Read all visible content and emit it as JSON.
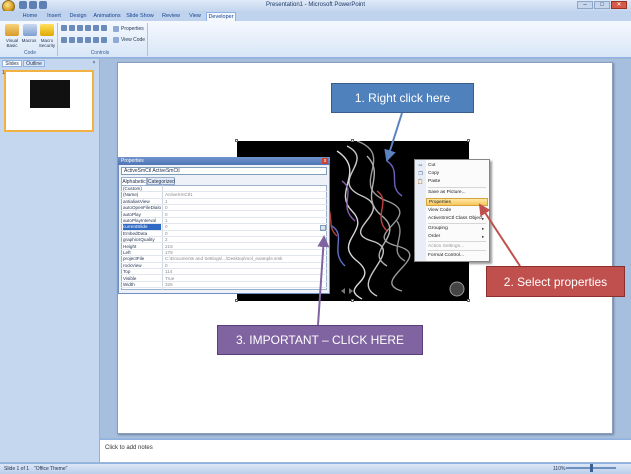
{
  "window": {
    "title": "Presentation1 - Microsoft PowerPoint",
    "min": "–",
    "max": "□",
    "close": "✕"
  },
  "ribbon": {
    "tabs": [
      "Home",
      "Insert",
      "Design",
      "Animations",
      "Slide Show",
      "Review",
      "View",
      "Developer"
    ],
    "active_tab": "Developer",
    "groups": {
      "code": {
        "label": "Code",
        "visual_basic": "Visual Basic",
        "macros": "Macros",
        "macro_security": "Macro Security"
      },
      "controls": {
        "label": "Controls",
        "properties": "Properties",
        "view_code": "View Code"
      }
    }
  },
  "left_pane": {
    "tab_slides": "Slides",
    "tab_outline": "Outline",
    "close": "×",
    "thumb_number": "1"
  },
  "notes": {
    "placeholder": "Click to add notes"
  },
  "status": {
    "slide": "Slide 1 of 1",
    "theme": "\"Office Theme\"",
    "zoom": "110%"
  },
  "properties": {
    "title": "Properties",
    "close": "x",
    "combo": "ActiveSmCtl  ActiveSmCtl",
    "tab_alphabetic": "Alphabetic",
    "tab_categorized": "Categorized",
    "rows": [
      {
        "k": "(Custom)",
        "v": ""
      },
      {
        "k": "(Name)",
        "v": "ActiveSmCtl1"
      },
      {
        "k": "antialiasView",
        "v": "1"
      },
      {
        "k": "autoOpenFileDialog",
        "v": "0"
      },
      {
        "k": "autoPlay",
        "v": "0"
      },
      {
        "k": "autoPlayInterval",
        "v": "1"
      },
      {
        "k": "currentSlide",
        "v": "0"
      },
      {
        "k": "EmbedData",
        "v": "0"
      },
      {
        "k": "graphicsQuality",
        "v": "2"
      },
      {
        "k": "Height",
        "v": "216"
      },
      {
        "k": "Left",
        "v": "178"
      },
      {
        "k": "projectFile",
        "v": "C:\\Documents and Settings\\...\\Desktop\\mol_example.smk"
      },
      {
        "k": "rockView",
        "v": "0"
      },
      {
        "k": "Top",
        "v": "114"
      },
      {
        "k": "Visible",
        "v": "True"
      },
      {
        "k": "Width",
        "v": "326"
      }
    ],
    "ellipsis": "..."
  },
  "context_menu": {
    "items": [
      {
        "label": "Cut",
        "icon": "✂",
        "disabled": false
      },
      {
        "label": "Copy",
        "icon": "❐",
        "disabled": false
      },
      {
        "label": "Paste",
        "icon": "📋",
        "disabled": false
      },
      {
        "label": "Save as Picture...",
        "icon": "",
        "disabled": false
      },
      {
        "label": "Properties",
        "icon": "",
        "disabled": false,
        "highlighted": true
      },
      {
        "label": "View Code",
        "icon": "",
        "disabled": false
      },
      {
        "label": "ActiveSmCtl Class Object",
        "icon": "",
        "disabled": false,
        "submenu": true
      },
      {
        "label": "Grouping",
        "icon": "",
        "disabled": false,
        "submenu": true
      },
      {
        "label": "Order",
        "icon": "",
        "disabled": false,
        "submenu": true
      },
      {
        "label": "Action Settings...",
        "icon": "",
        "disabled": true
      },
      {
        "label": "Format Control...",
        "icon": "",
        "disabled": false
      }
    ],
    "submenu_arrow": "▸"
  },
  "callouts": {
    "c1": "1. Right click here",
    "c2": "2. Select properties",
    "c3": "3. IMPORTANT – CLICK HERE"
  },
  "colors": {
    "callout1": "#4f81bd",
    "callout2": "#c0504d",
    "callout3": "#8064a2",
    "arrow_blue": "#5b83c0",
    "arrow_red": "#c0504d",
    "arrow_purple": "#8064a2"
  }
}
